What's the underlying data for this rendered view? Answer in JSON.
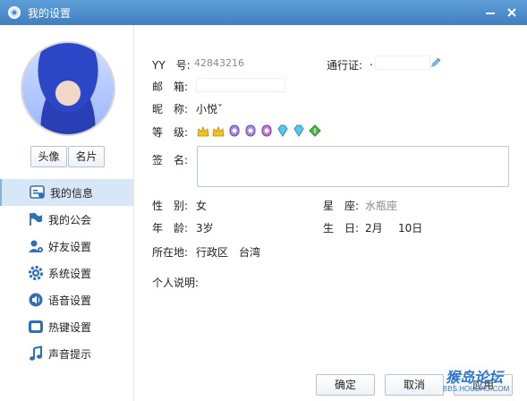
{
  "window": {
    "title": "我的设置"
  },
  "sidebar": {
    "avatar_buttons": [
      "头像",
      "名片"
    ],
    "items": [
      {
        "label": "我的信息",
        "icon": "profile-card-icon",
        "active": true
      },
      {
        "label": "我的公会",
        "icon": "flag-icon",
        "active": false
      },
      {
        "label": "好友设置",
        "icon": "friends-icon",
        "active": false
      },
      {
        "label": "系统设置",
        "icon": "gear-icon",
        "active": false
      },
      {
        "label": "语音设置",
        "icon": "speaker-icon",
        "active": false
      },
      {
        "label": "热键设置",
        "icon": "keyboard-icon",
        "active": false
      },
      {
        "label": "声音提示",
        "icon": "music-note-icon",
        "active": false
      }
    ]
  },
  "profile": {
    "yy_label": "YY　号:",
    "yy_value": "42843216",
    "pass_label": "通行证:",
    "pass_value_prefix": ".",
    "email_label": "邮　箱:",
    "nickname_label": "昵　称:",
    "nickname_value": "小悦ˇ",
    "level_label": "等　级:",
    "signature_label": "签　名:",
    "gender_label": "性　别:",
    "gender_value": "女",
    "star_label": "星　座:",
    "star_value": "水瓶座",
    "age_label": "年　龄:",
    "age_value": "3岁",
    "birthday_label": "生　日:",
    "birthday_month": "2月",
    "birthday_day": "10日",
    "location_label": "所在地:",
    "location_value": "行政区　台湾",
    "personal_label": "个人说明:"
  },
  "footer": {
    "ok_label": "确定",
    "cancel_label": "取消",
    "apply_label": "应用"
  },
  "watermark": {
    "main": "猴岛论坛",
    "url": "BBS.HOUDAO.COM"
  },
  "colors": {
    "titlebar": "#4f8fd0",
    "nav_active": "#d7e7f7",
    "accent": "#3d7fc1"
  }
}
